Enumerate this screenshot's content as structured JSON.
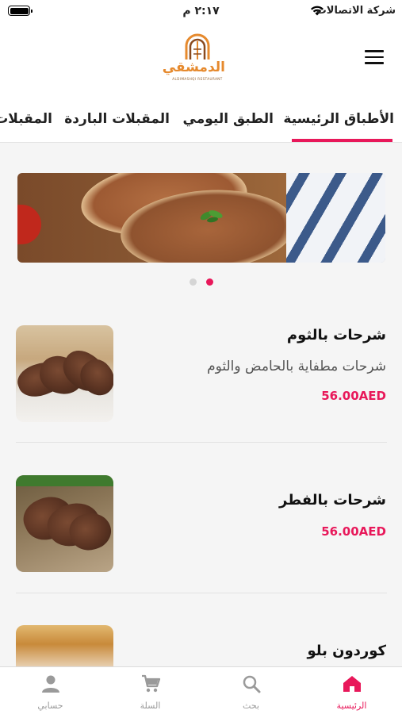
{
  "status_bar": {
    "carrier": "شركة الاتصالات",
    "time": "٢:١٧ م"
  },
  "brand": {
    "name": "الدمشقي",
    "tagline": "ALDIMASHQI RESTAURANT",
    "color": "#e68a2e"
  },
  "tabs": [
    {
      "label": "الأطباق الرئيسية",
      "active": true
    },
    {
      "label": "الطبق اليومي",
      "active": false
    },
    {
      "label": "المقبلات الباردة",
      "active": false
    },
    {
      "label": "المقبلات",
      "active": false
    }
  ],
  "carousel": {
    "slide_count": 2,
    "active_index": 0
  },
  "menu_items": [
    {
      "name": "شرحات بالثوم",
      "description": "شرحات مطفاية بالحامض والثوم",
      "price": "56.00AED"
    },
    {
      "name": "شرحات بالفطر",
      "description": "",
      "price": "56.00AED"
    },
    {
      "name": "كوردون بلو",
      "description": "",
      "price": ""
    }
  ],
  "bottom_nav": [
    {
      "label": "الرئيسية",
      "icon": "home-icon",
      "active": true
    },
    {
      "label": "بحث",
      "icon": "search-icon",
      "active": false
    },
    {
      "label": "السلة",
      "icon": "cart-icon",
      "active": false
    },
    {
      "label": "حسابي",
      "icon": "user-icon",
      "active": false
    }
  ],
  "colors": {
    "accent": "#e8185a",
    "inactive_nav": "#9a9a9a"
  }
}
